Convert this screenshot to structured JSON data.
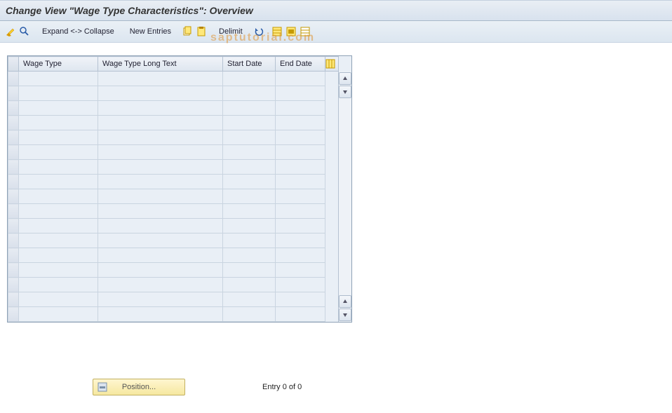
{
  "title": "Change View \"Wage Type Characteristics\": Overview",
  "toolbar": {
    "expand_collapse": "Expand <-> Collapse",
    "new_entries": "New Entries",
    "delimit": "Delimit"
  },
  "icons": {
    "pencil_glasses": "change-icon",
    "find": "find-icon",
    "copy": "copy-icon",
    "paste": "paste-icon",
    "undo": "undo-icon",
    "select_all": "select-all-icon",
    "select_block": "select-block-icon",
    "deselect_all": "deselect-all-icon",
    "config_col": "configure-columns-icon",
    "position": "position-icon"
  },
  "table": {
    "headers": {
      "wage_type": "Wage Type",
      "long_text": "Wage Type Long Text",
      "start_date": "Start Date",
      "end_date": "End Date"
    },
    "row_count": 17,
    "rows": [
      {
        "wage_type": "",
        "long_text": "",
        "start_date": "",
        "end_date": ""
      },
      {
        "wage_type": "",
        "long_text": "",
        "start_date": "",
        "end_date": ""
      },
      {
        "wage_type": "",
        "long_text": "",
        "start_date": "",
        "end_date": ""
      },
      {
        "wage_type": "",
        "long_text": "",
        "start_date": "",
        "end_date": ""
      },
      {
        "wage_type": "",
        "long_text": "",
        "start_date": "",
        "end_date": ""
      },
      {
        "wage_type": "",
        "long_text": "",
        "start_date": "",
        "end_date": ""
      },
      {
        "wage_type": "",
        "long_text": "",
        "start_date": "",
        "end_date": ""
      },
      {
        "wage_type": "",
        "long_text": "",
        "start_date": "",
        "end_date": ""
      },
      {
        "wage_type": "",
        "long_text": "",
        "start_date": "",
        "end_date": ""
      },
      {
        "wage_type": "",
        "long_text": "",
        "start_date": "",
        "end_date": ""
      },
      {
        "wage_type": "",
        "long_text": "",
        "start_date": "",
        "end_date": ""
      },
      {
        "wage_type": "",
        "long_text": "",
        "start_date": "",
        "end_date": ""
      },
      {
        "wage_type": "",
        "long_text": "",
        "start_date": "",
        "end_date": ""
      },
      {
        "wage_type": "",
        "long_text": "",
        "start_date": "",
        "end_date": ""
      },
      {
        "wage_type": "",
        "long_text": "",
        "start_date": "",
        "end_date": ""
      },
      {
        "wage_type": "",
        "long_text": "",
        "start_date": "",
        "end_date": ""
      },
      {
        "wage_type": "",
        "long_text": "",
        "start_date": "",
        "end_date": ""
      }
    ]
  },
  "footer": {
    "position_label": "Position...",
    "entry_text": "Entry 0 of 0"
  },
  "watermark": "saptutorial.com",
  "colors": {
    "header_bg": "#dbe4ef",
    "accent_yellow": "#f6e8a0"
  }
}
